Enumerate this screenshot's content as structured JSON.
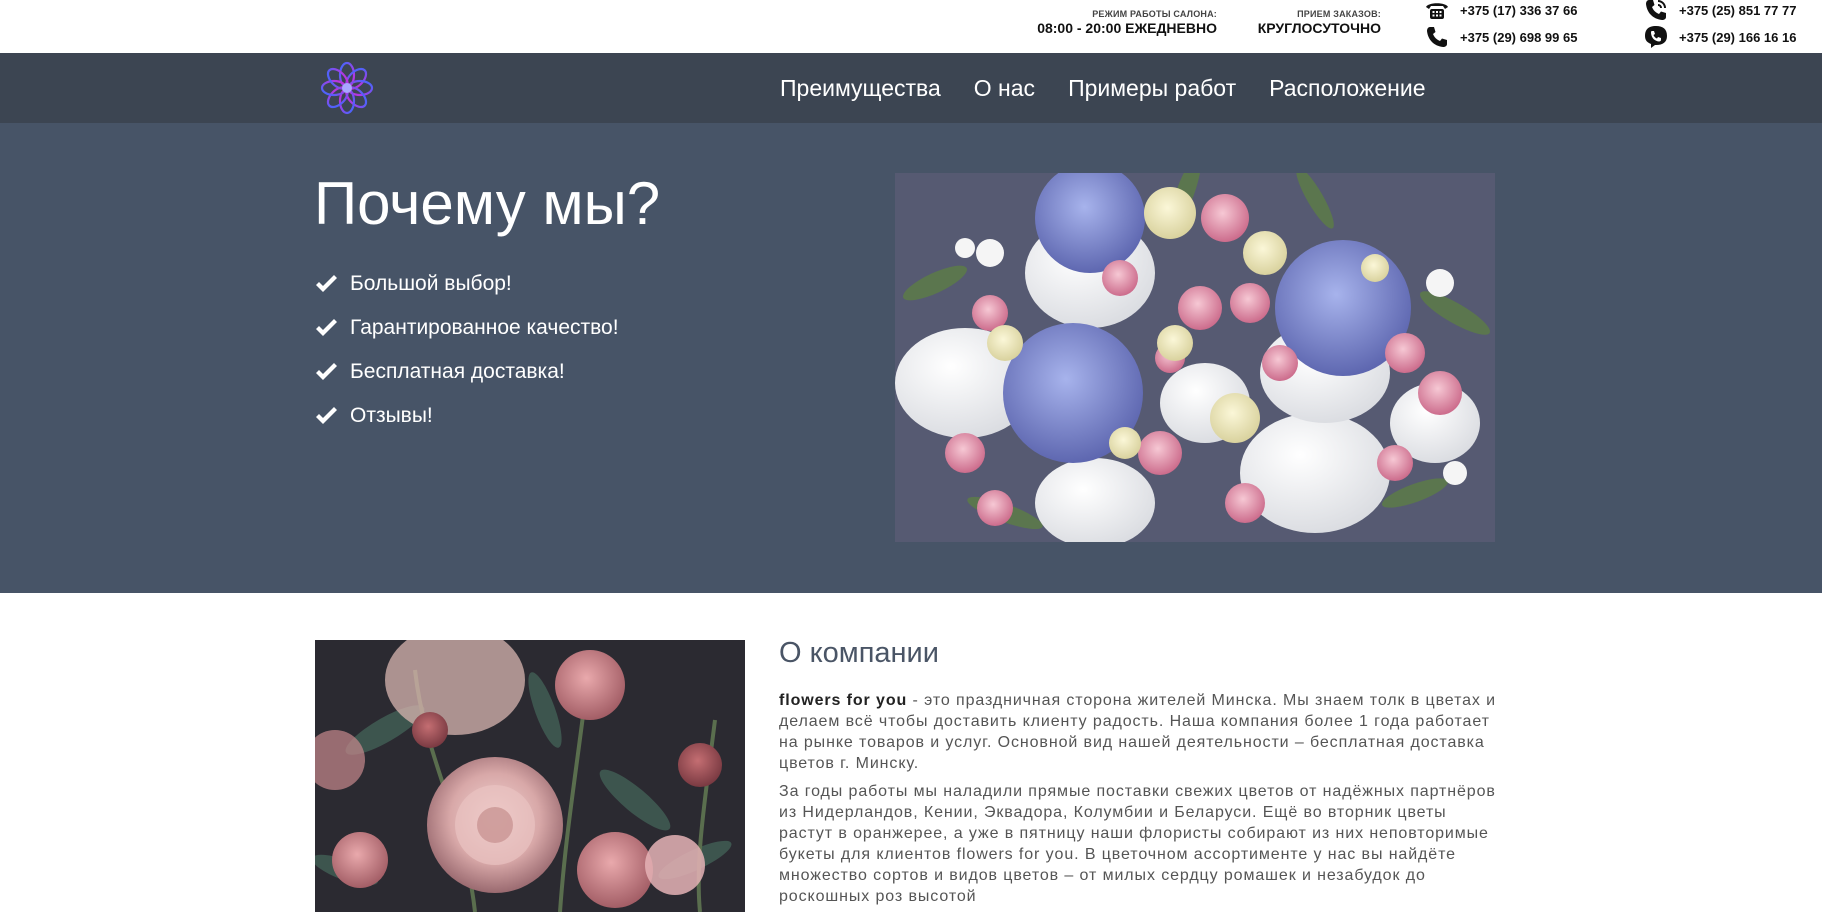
{
  "topbar": {
    "hours_label": "РЕЖИМ РАБОТЫ САЛОНА:",
    "hours_value": "08:00 - 20:00 ЕЖЕДНЕВНО",
    "orders_label": "ПРИЕМ ЗАКАЗОВ:",
    "orders_value": "КРУГЛОСУТОЧНО",
    "phones": [
      {
        "icon": "landline-phone-icon",
        "number": "+375 (17) 336 37 66"
      },
      {
        "icon": "phone-handset-icon",
        "number": "+375 (29) 698 99 65"
      },
      {
        "icon": "phone-call-icon",
        "number": "+375 (25) 851 77 77"
      },
      {
        "icon": "viber-icon",
        "number": "+375 (29) 166 16 16"
      }
    ]
  },
  "nav": {
    "logo_icon": "flower-logo-icon",
    "items": [
      "Преимущества",
      "О нас",
      "Примеры работ",
      "Расположение"
    ]
  },
  "hero": {
    "title": "Почему мы?",
    "bullets": [
      "Большой выбор!",
      "Гарантированное качество!",
      "Бесплатная доставка!",
      "Отзывы!"
    ],
    "photo": "flower-bouquet-photo"
  },
  "about": {
    "title": "О компании",
    "brand": "flowers for you",
    "paragraph1_rest": " - это праздничная сторона жителей Минска. Мы знаем толк в цветах и делаем всё чтобы доставить клиенту радость. Наша компания более 1 года работает на рынке товаров и услуг. Основной вид нашей деятельности – бесплатная доставка цветов г. Минску.",
    "paragraph2": "За годы работы мы наладили прямые поставки свежих цветов от надёжных партнёров из Нидерландов, Кении, Эквадора, Колумбии и Беларуси. Ещё во вторник цветы растут в оранжерее, а уже в пятницу наши флористы собирают из них неповторимые букеты для клиентов flowers for you. В цветочном ассортименте у нас вы найдёте множество сортов и видов цветов – от милых сердцу ромашек и незабудок до роскошных роз высотой",
    "photo": "peony-roses-photo"
  },
  "colors": {
    "navbar": "#3c4552",
    "hero": "#475467",
    "about_title": "#4a5566"
  }
}
